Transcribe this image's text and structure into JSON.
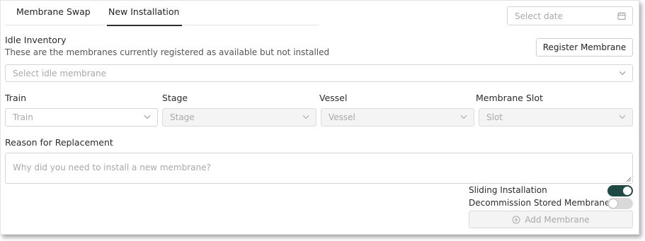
{
  "tabs": [
    {
      "label": "Membrane Swap",
      "active": false
    },
    {
      "label": "New Installation",
      "active": true
    }
  ],
  "date_input": {
    "placeholder": "Select date",
    "icon": "calendar-icon"
  },
  "idle_inventory": {
    "title": "Idle Inventory",
    "description": "These are the membranes currently registered as available but not installed",
    "register_button": "Register Membrane",
    "select_placeholder": "Select idle membrane"
  },
  "fields": {
    "train": {
      "label": "Train",
      "placeholder": "Train",
      "disabled": false
    },
    "stage": {
      "label": "Stage",
      "placeholder": "Stage",
      "disabled": true
    },
    "vessel": {
      "label": "Vessel",
      "placeholder": "Vessel",
      "disabled": true
    },
    "slot": {
      "label": "Membrane Slot",
      "placeholder": "Slot",
      "disabled": true
    }
  },
  "reason": {
    "label": "Reason for Replacement",
    "placeholder": "Why did you need to install a new membrane?"
  },
  "toggles": {
    "sliding": {
      "label": "Sliding Installation",
      "on": true
    },
    "decommission": {
      "label": "Decommission Stored Membrane",
      "on": false
    }
  },
  "add_button": {
    "label": "Add Membrane",
    "icon": "plus-circle-icon",
    "disabled": true
  },
  "colors": {
    "toggle_on": "#1f4a43",
    "toggle_off": "#d9d9d9"
  }
}
